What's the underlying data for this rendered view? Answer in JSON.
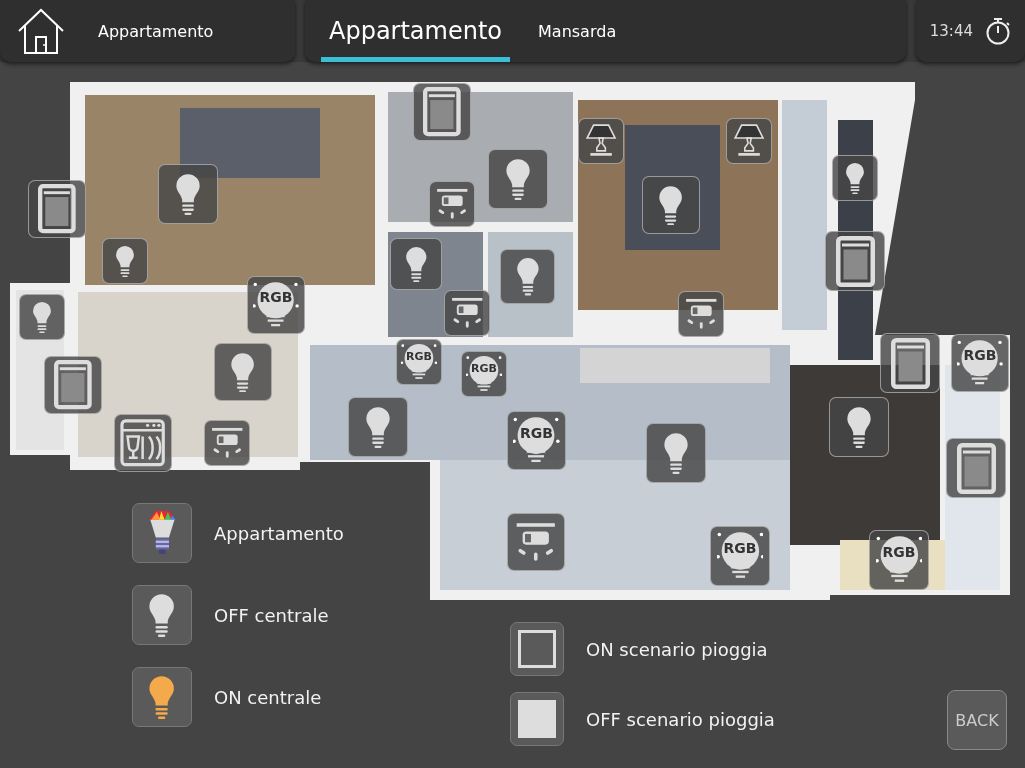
{
  "header": {
    "home_label": "Appartamento",
    "tabs": [
      {
        "label": "Appartamento",
        "selected": true
      },
      {
        "label": "Mansarda",
        "selected": false
      }
    ],
    "time": "13:44"
  },
  "devices": [
    {
      "kind": "shutter"
    },
    {
      "kind": "light"
    },
    {
      "kind": "light"
    },
    {
      "kind": "rgb",
      "label": "RGB"
    },
    {
      "kind": "light"
    },
    {
      "kind": "shutter"
    },
    {
      "kind": "light"
    },
    {
      "kind": "dishwasher"
    },
    {
      "kind": "aircon"
    },
    {
      "kind": "shutter"
    },
    {
      "kind": "light"
    },
    {
      "kind": "aircon"
    },
    {
      "kind": "lamp"
    },
    {
      "kind": "lamp"
    },
    {
      "kind": "light"
    },
    {
      "kind": "light"
    },
    {
      "kind": "shutter"
    },
    {
      "kind": "light"
    },
    {
      "kind": "light"
    },
    {
      "kind": "aircon"
    },
    {
      "kind": "aircon"
    },
    {
      "kind": "rgb",
      "label": "RGB"
    },
    {
      "kind": "rgb",
      "label": "RGB"
    },
    {
      "kind": "light"
    },
    {
      "kind": "rgb",
      "label": "RGB"
    },
    {
      "kind": "light"
    },
    {
      "kind": "shutter"
    },
    {
      "kind": "rgb",
      "label": "RGB"
    },
    {
      "kind": "light"
    },
    {
      "kind": "shutter"
    },
    {
      "kind": "aircon"
    },
    {
      "kind": "rgb",
      "label": "RGB"
    },
    {
      "kind": "rgb",
      "label": "RGB"
    }
  ],
  "legend": [
    {
      "kind": "rgb",
      "label": "Appartamento"
    },
    {
      "kind": "off",
      "label": "OFF centrale"
    },
    {
      "kind": "on",
      "label": "ON centrale"
    }
  ],
  "scenarios": [
    {
      "kind": "on",
      "label": "ON scenario pioggia"
    },
    {
      "kind": "off",
      "label": "OFF scenario pioggia"
    }
  ],
  "back": "BACK"
}
